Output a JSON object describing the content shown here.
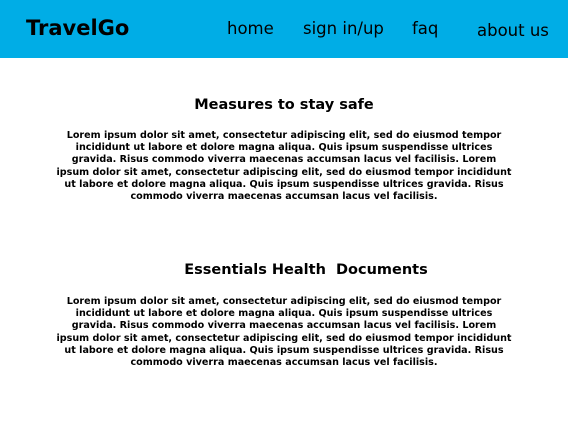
{
  "header": {
    "brand": "TravelGo",
    "nav": {
      "home": "home",
      "sign_in_up": "sign in/up",
      "faq": "faq",
      "about_us": "about us"
    }
  },
  "sections": [
    {
      "title": "Measures to stay safe",
      "body": "Lorem ipsum dolor sit amet, consectetur adipiscing elit, sed do eiusmod tempor incididunt ut labore et dolore magna aliqua. Quis ipsum suspendisse ultrices gravida. Risus commodo viverra maecenas accumsan lacus vel facilisis. Lorem ipsum dolor sit amet, consectetur adipiscing elit, sed do eiusmod tempor incididunt ut labore et dolore magna aliqua. Quis ipsum suspendisse ultrices gravida. Risus commodo viverra maecenas accumsan lacus vel facilisis."
    },
    {
      "title": "Essentials Health  Documents",
      "body": "Lorem ipsum dolor sit amet, consectetur adipiscing elit, sed do eiusmod tempor incididunt ut labore et dolore magna aliqua. Quis ipsum suspendisse ultrices gravida. Risus commodo viverra maecenas accumsan lacus vel facilisis. Lorem ipsum dolor sit amet, consectetur adipiscing elit, sed do eiusmod tempor incididunt ut labore et dolore magna aliqua. Quis ipsum suspendisse ultrices gravida. Risus commodo viverra maecenas accumsan lacus vel facilisis."
    }
  ],
  "colors": {
    "header_background": "#00ade6",
    "page_background": "#ffffff",
    "text": "#000000"
  }
}
